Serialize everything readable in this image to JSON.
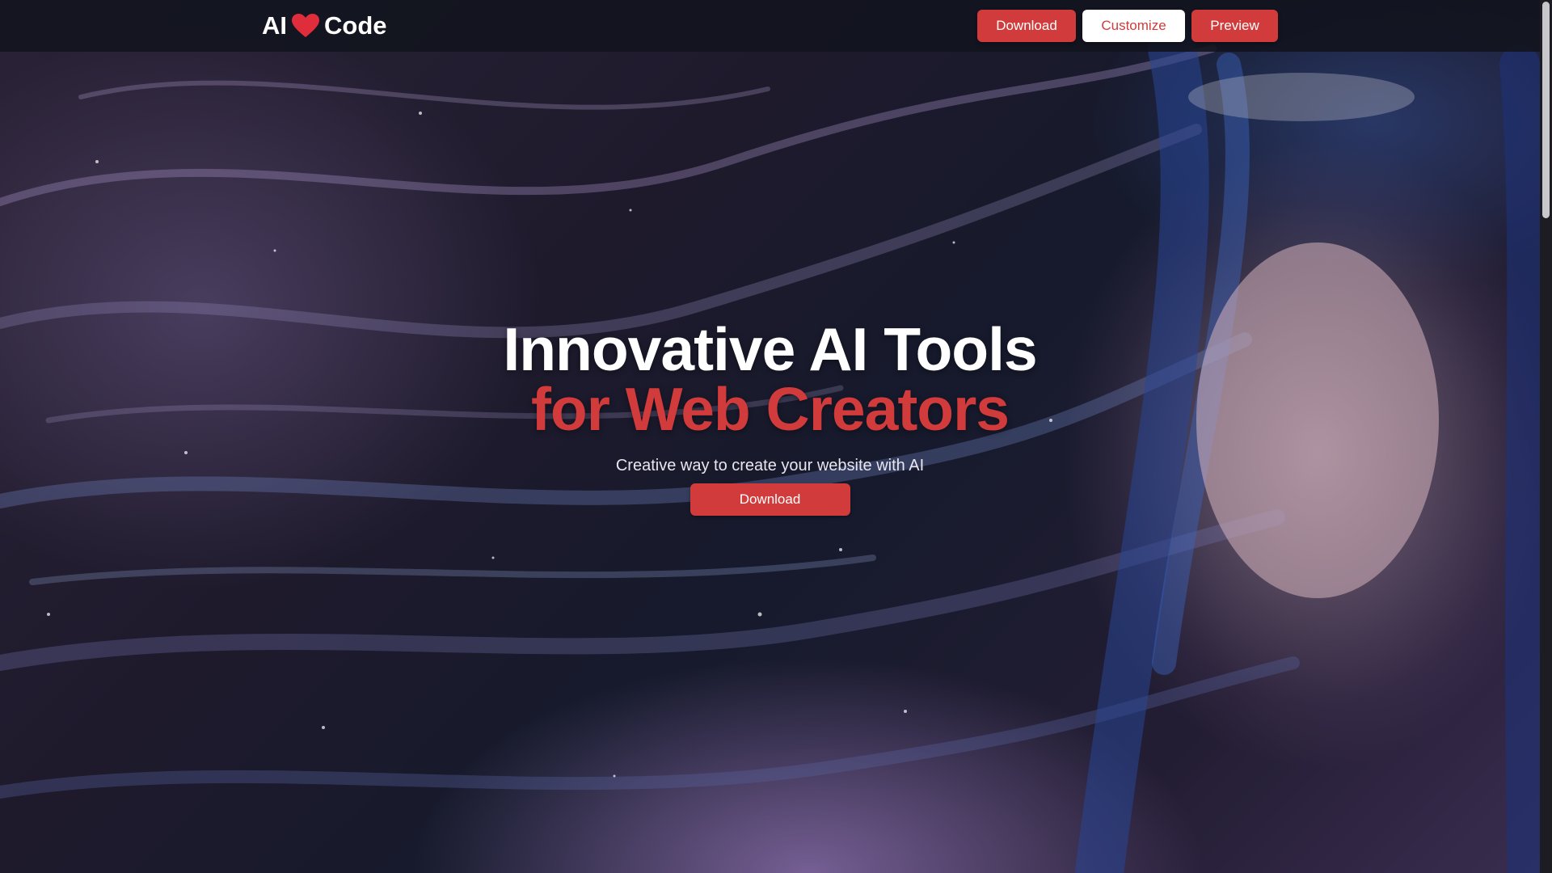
{
  "brand": {
    "part1": "AI",
    "icon": "heart-icon",
    "part2": "Code"
  },
  "nav": {
    "download_label": "Download",
    "customize_label": "Customize",
    "preview_label": "Preview"
  },
  "hero": {
    "title_line1": "Innovative AI Tools",
    "title_line2": "for Web Creators",
    "subtitle": "Creative way to create your website with AI",
    "cta_label": "Download"
  },
  "colors": {
    "accent": "#d13b3b",
    "header_bg": "#12141e",
    "text": "#ffffff"
  }
}
